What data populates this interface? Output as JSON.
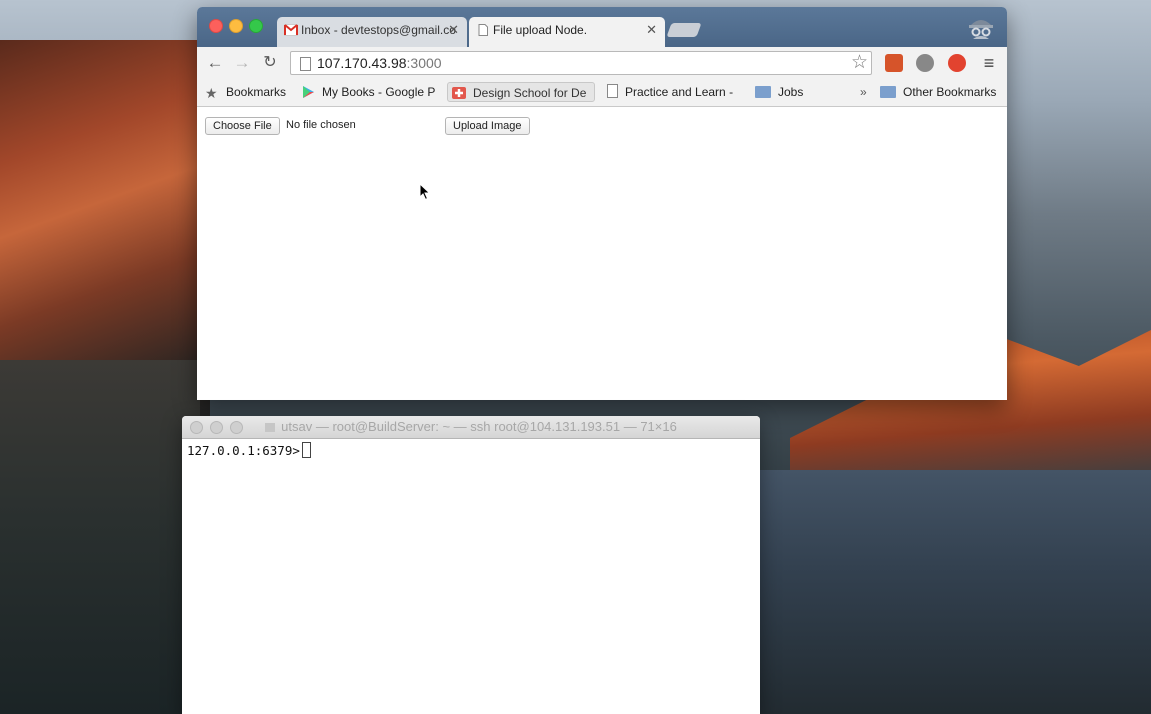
{
  "browser": {
    "tabs": [
      {
        "label": "Inbox - devtestops@gmail.co",
        "icon": "gmail-icon",
        "active": false
      },
      {
        "label": "File upload Node.",
        "icon": "page-icon",
        "active": true
      }
    ],
    "address": {
      "host": "107.170.43.98",
      "port": ":3000"
    },
    "bookmarks": [
      {
        "label": "Bookmarks",
        "icon": "star-icon"
      },
      {
        "label": "My Books - Google P",
        "icon": "google-play-icon"
      },
      {
        "label": "Design School for De",
        "icon": "design-school-icon"
      },
      {
        "label": "Practice and Learn -",
        "icon": "page-icon"
      },
      {
        "label": "Jobs",
        "icon": "folder-icon"
      }
    ],
    "overflow": "»",
    "other_bookmarks": "Other Bookmarks",
    "colors": {
      "tabstrip": "#4a6687",
      "toolbar": "#f2f2f2",
      "folder": "#7b9fcd"
    }
  },
  "page": {
    "choose_file_label": "Choose File",
    "file_status": "No file chosen",
    "upload_label": "Upload Image"
  },
  "terminal": {
    "title": "utsav — root@BuildServer: ~ — ssh root@104.131.193.51 — 71×16",
    "prompt": "127.0.0.1:6379>"
  }
}
